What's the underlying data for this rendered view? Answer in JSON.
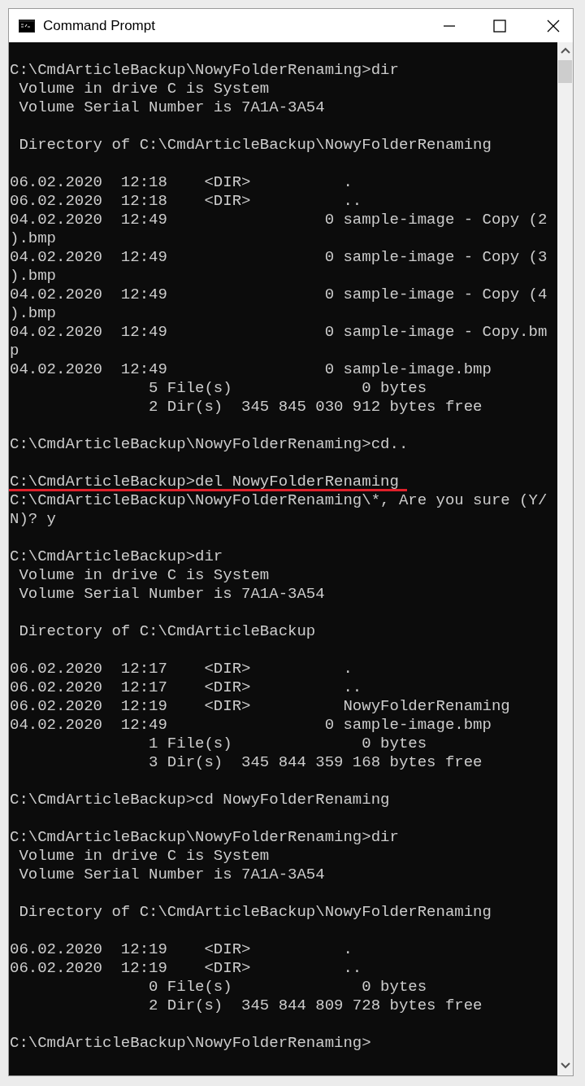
{
  "window": {
    "title": "Command Prompt"
  },
  "console": {
    "blocks": [
      [
        {
          "text": "C:\\CmdArticleBackup\\NowyFolderRenaming>dir",
          "underlined": false
        },
        {
          "text": " Volume in drive C is System",
          "underlined": false
        },
        {
          "text": " Volume Serial Number is 7A1A-3A54",
          "underlined": false
        }
      ],
      [
        {
          "text": " Directory of C:\\CmdArticleBackup\\NowyFolderRenaming",
          "underlined": false
        }
      ],
      [
        {
          "text": "06.02.2020  12:18    <DIR>          .",
          "underlined": false
        },
        {
          "text": "06.02.2020  12:18    <DIR>          ..",
          "underlined": false
        },
        {
          "text": "04.02.2020  12:49                 0 sample-image - Copy (2",
          "underlined": false
        },
        {
          "text": ").bmp",
          "underlined": false
        },
        {
          "text": "04.02.2020  12:49                 0 sample-image - Copy (3",
          "underlined": false
        },
        {
          "text": ").bmp",
          "underlined": false
        },
        {
          "text": "04.02.2020  12:49                 0 sample-image - Copy (4",
          "underlined": false
        },
        {
          "text": ").bmp",
          "underlined": false
        },
        {
          "text": "04.02.2020  12:49                 0 sample-image - Copy.bm",
          "underlined": false
        },
        {
          "text": "p",
          "underlined": false
        },
        {
          "text": "04.02.2020  12:49                 0 sample-image.bmp",
          "underlined": false
        },
        {
          "text": "               5 File(s)              0 bytes",
          "underlined": false
        },
        {
          "text": "               2 Dir(s)  345 845 030 912 bytes free",
          "underlined": false
        }
      ],
      [
        {
          "text": "C:\\CmdArticleBackup\\NowyFolderRenaming>cd..",
          "underlined": false
        }
      ],
      [
        {
          "text": "C:\\CmdArticleBackup>del NowyFolderRenaming",
          "underlined": true
        },
        {
          "text": "C:\\CmdArticleBackup\\NowyFolderRenaming\\*, Are you sure (Y/",
          "underlined": false
        },
        {
          "text": "N)? y",
          "underlined": false
        }
      ],
      [
        {
          "text": "C:\\CmdArticleBackup>dir",
          "underlined": false
        },
        {
          "text": " Volume in drive C is System",
          "underlined": false
        },
        {
          "text": " Volume Serial Number is 7A1A-3A54",
          "underlined": false
        }
      ],
      [
        {
          "text": " Directory of C:\\CmdArticleBackup",
          "underlined": false
        }
      ],
      [
        {
          "text": "06.02.2020  12:17    <DIR>          .",
          "underlined": false
        },
        {
          "text": "06.02.2020  12:17    <DIR>          ..",
          "underlined": false
        },
        {
          "text": "06.02.2020  12:19    <DIR>          NowyFolderRenaming",
          "underlined": false
        },
        {
          "text": "04.02.2020  12:49                 0 sample-image.bmp",
          "underlined": false
        },
        {
          "text": "               1 File(s)              0 bytes",
          "underlined": false
        },
        {
          "text": "               3 Dir(s)  345 844 359 168 bytes free",
          "underlined": false
        }
      ],
      [
        {
          "text": "C:\\CmdArticleBackup>cd NowyFolderRenaming",
          "underlined": false
        }
      ],
      [
        {
          "text": "C:\\CmdArticleBackup\\NowyFolderRenaming>dir",
          "underlined": false
        },
        {
          "text": " Volume in drive C is System",
          "underlined": false
        },
        {
          "text": " Volume Serial Number is 7A1A-3A54",
          "underlined": false
        }
      ],
      [
        {
          "text": " Directory of C:\\CmdArticleBackup\\NowyFolderRenaming",
          "underlined": false
        }
      ],
      [
        {
          "text": "06.02.2020  12:19    <DIR>          .",
          "underlined": false
        },
        {
          "text": "06.02.2020  12:19    <DIR>          ..",
          "underlined": false
        },
        {
          "text": "               0 File(s)              0 bytes",
          "underlined": false
        },
        {
          "text": "               2 Dir(s)  345 844 809 728 bytes free",
          "underlined": false
        }
      ],
      [
        {
          "text": "C:\\CmdArticleBackup\\NowyFolderRenaming>",
          "underlined": false
        }
      ]
    ]
  }
}
